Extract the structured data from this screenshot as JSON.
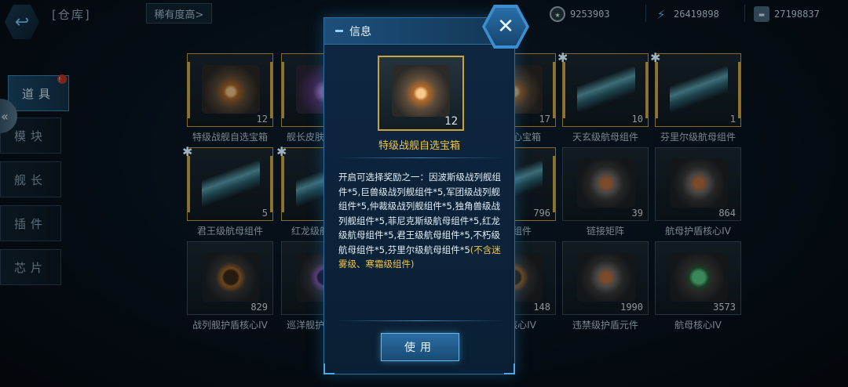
{
  "topbar": {
    "back_icon": "back-arrow-icon",
    "title": "[仓库]",
    "sort_label": "稀有度高>",
    "currencies": [
      {
        "name": "coin",
        "icon": "coin-icon",
        "value": "9253903"
      },
      {
        "name": "energy",
        "icon": "lightning-icon",
        "value": "26419898"
      },
      {
        "name": "alloy",
        "icon": "ingot-icon",
        "value": "27198837"
      }
    ]
  },
  "sidebar": {
    "items": [
      {
        "label": "道具",
        "active": true,
        "badge": "!"
      },
      {
        "label": "模块",
        "active": false
      },
      {
        "label": "舰长",
        "active": false
      },
      {
        "label": "插件",
        "active": false
      },
      {
        "label": "芯片",
        "active": false
      }
    ]
  },
  "grid": {
    "rows": [
      [
        {
          "name": "特级战舰自选宝箱",
          "count": "12",
          "thumb": "chest",
          "gold": true
        },
        {
          "name": "舰长皮肤自选宝箱",
          "count": "",
          "thumb": "chest-purple",
          "gold": true
        },
        {
          "name": "",
          "count": "",
          "thumb": "chest",
          "gold": false
        },
        {
          "name": "航母核心宝箱",
          "count": "17",
          "thumb": "chest",
          "gold": true
        },
        {
          "name": "天玄级航母组件",
          "count": "10",
          "thumb": "ship",
          "gold": true,
          "puzzle": true
        },
        {
          "name": "芬里尔级航母组件",
          "count": "1",
          "thumb": "ship",
          "gold": true,
          "puzzle": true
        }
      ],
      [
        {
          "name": "君王级航母组件",
          "count": "5",
          "thumb": "ship",
          "gold": true,
          "puzzle": true
        },
        {
          "name": "红龙级航母组件",
          "count": "",
          "thumb": "ship",
          "gold": true,
          "puzzle": true
        },
        {
          "name": "",
          "count": "",
          "thumb": "ship",
          "gold": false
        },
        {
          "name": "航母组件",
          "count": "796",
          "thumb": "ship",
          "gold": true
        },
        {
          "name": "链接矩阵",
          "count": "39",
          "thumb": "mech",
          "gold": false
        },
        {
          "name": "航母护盾核心IV",
          "count": "864",
          "thumb": "mech",
          "gold": false
        }
      ],
      [
        {
          "name": "战列舰护盾核心IV",
          "count": "829",
          "thumb": "shield",
          "gold": false
        },
        {
          "name": "巡洋舰护盾核心IV",
          "count": "",
          "thumb": "shield-purple",
          "gold": false
        },
        {
          "name": "",
          "count": "",
          "thumb": "shield",
          "gold": false
        },
        {
          "name": "护盾核心IV",
          "count": "148",
          "thumb": "shield",
          "gold": false
        },
        {
          "name": "违禁级护盾元件",
          "count": "1990",
          "thumb": "mech",
          "gold": false
        },
        {
          "name": "航母核心IV",
          "count": "3573",
          "thumb": "green",
          "gold": false
        }
      ]
    ]
  },
  "modal": {
    "title": "信息",
    "close_icon": "close-icon",
    "item_name": "特级战舰自选宝箱",
    "item_count": "12",
    "description": "开启可选择奖励之一：因波斯级战列舰组件*5,巨兽级战列舰组件*5,军团级战列舰组件*5,仲裁级战列舰组件*5,独角兽级战列舰组件*5,菲尼克斯级航母组件*5,红龙级航母组件*5,君王级航母组件*5,不朽级航母组件*5,芬里尔级航母组件*5",
    "description_note": "(不含迷雾级、寒霜级组件)",
    "use_label": "使用"
  }
}
